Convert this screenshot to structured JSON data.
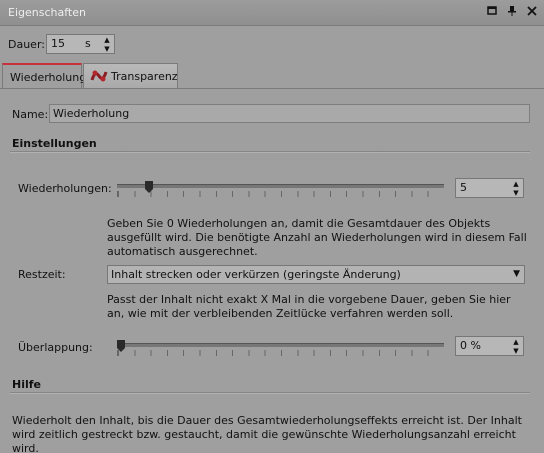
{
  "window": {
    "title": "Eigenschaften"
  },
  "duration": {
    "label": "Dauer:",
    "value": "15",
    "unit": "s"
  },
  "tabs": [
    {
      "label": "Wiederholung",
      "active": true
    },
    {
      "label": "Transparenz",
      "active": false,
      "icon": "transparency-icon"
    }
  ],
  "name": {
    "label": "Name:",
    "value": "Wiederholung"
  },
  "settings": {
    "heading": "Einstellungen",
    "repetitions": {
      "label": "Wiederholungen:",
      "value": "5",
      "slider_fraction": 0.05,
      "description": "Geben Sie 0 Wiederholungen an, damit die Gesamtdauer des Objekts ausgefüllt wird. Die benötigte Anzahl an Wiederholungen wird in diesem Fall automatisch ausgerechnet."
    },
    "remaining": {
      "label": "Restzeit:",
      "value": "Inhalt strecken oder verkürzen (geringste Änderung)",
      "description": "Passt der Inhalt nicht exakt X Mal in die vorgebene Dauer, geben Sie hier an, wie mit der verbleibenden Zeitlücke verfahren werden soll."
    },
    "overlap": {
      "label": "Überlappung:",
      "value": "0 %",
      "slider_fraction": 0.0
    }
  },
  "help": {
    "heading": "Hilfe",
    "text": "Wiederholt den Inhalt, bis die Dauer des Gesamtwiederholungseffekts erreicht ist. Der Inhalt wird zeitlich gestreckt bzw. gestaucht, damit die gewünschte Wiederholungsanzahl erreicht wird."
  },
  "colors": {
    "accent": "#c8323a",
    "panel": "#9f9f9f"
  }
}
